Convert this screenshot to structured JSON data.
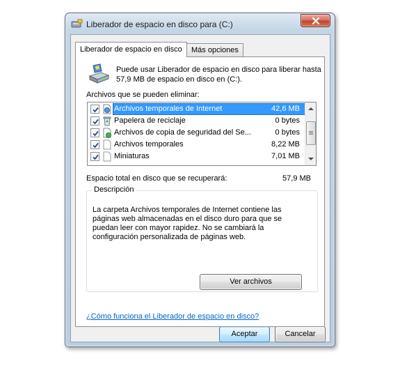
{
  "window": {
    "title": "Liberador de espacio en disco para  (C:)"
  },
  "tabs": [
    {
      "label": "Liberador de espacio en disco",
      "active": true
    },
    {
      "label": "Más opciones",
      "active": false
    }
  ],
  "intro": {
    "text": "Puede usar Liberador de espacio en disco para liberar hasta 57,9 MB de espacio en disco en  (C:)."
  },
  "files": {
    "label": "Archivos que se pueden eliminar:",
    "items": [
      {
        "name": "Archivos temporales de Internet",
        "size": "42,6 MB",
        "checked": true,
        "selected": true,
        "icon": "internet-files-icon"
      },
      {
        "name": "Papelera de reciclaje",
        "size": "0 bytes",
        "checked": true,
        "selected": false,
        "icon": "recycle-bin-icon"
      },
      {
        "name": "Archivos de copia de seguridad del Se...",
        "size": "0 bytes",
        "checked": true,
        "selected": false,
        "icon": "backup-files-icon"
      },
      {
        "name": "Archivos temporales",
        "size": "8,22 MB",
        "checked": true,
        "selected": false,
        "icon": "blank-file-icon"
      },
      {
        "name": "Miniaturas",
        "size": "7,01 MB",
        "checked": true,
        "selected": false,
        "icon": "blank-file-icon"
      }
    ]
  },
  "total": {
    "label": "Espacio total en disco que se recuperará:",
    "value": "57,9 MB"
  },
  "description": {
    "legend": "Descripción",
    "text": "La carpeta Archivos temporales de Internet contiene las páginas web almacenadas en el disco duro para que se puedan leer con mayor rapidez. No se cambiará la configuración personalizada de páginas web."
  },
  "buttons": {
    "view_files": "Ver archivos",
    "accept": "Aceptar",
    "cancel": "Cancelar"
  },
  "help_link": "¿Cómo funciona el Liberador de espacio en disco?",
  "colors": {
    "selection": "#3399ff",
    "link": "#0066cc",
    "close_button": "#c34329"
  }
}
